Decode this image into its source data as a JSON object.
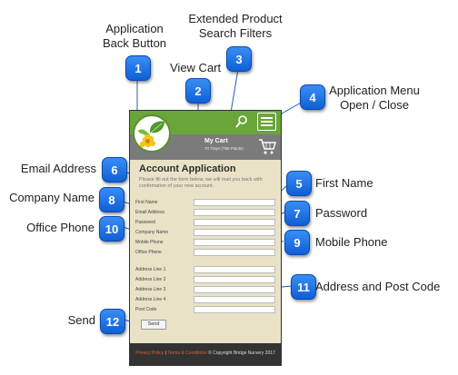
{
  "annotations": [
    {
      "num": "1",
      "text1": "Application",
      "text2": "Back Button"
    },
    {
      "num": "2",
      "text1": "View Cart"
    },
    {
      "num": "3",
      "text1": "Extended Product",
      "text2": "Search Filters"
    },
    {
      "num": "4",
      "text1": "Application Menu",
      "text2": "Open / Close"
    },
    {
      "num": "5",
      "text1": "First Name"
    },
    {
      "num": "6",
      "text1": "Email Address"
    },
    {
      "num": "7",
      "text1": "Password"
    },
    {
      "num": "8",
      "text1": "Company Name"
    },
    {
      "num": "9",
      "text1": "Mobile Phone"
    },
    {
      "num": "10",
      "text1": "Office Phone"
    },
    {
      "num": "11",
      "text1": "Address and Post Code"
    },
    {
      "num": "12",
      "text1": "Send"
    }
  ],
  "app": {
    "cart_title": "My Cart",
    "cart_subtitle": "70 Trays (780 Plants)",
    "form_title": "Account Application",
    "form_description": "Please fill out the form below, we will mail you back with confirmation of your new account.",
    "fields": [
      "First Name",
      "Email Address",
      "Password",
      "Company Name",
      "Mobile Phone",
      "Office Phone"
    ],
    "address_fields": [
      "Address Line 1",
      "Address Line 2",
      "Address Line 3",
      "Address Line 4",
      "Post Code"
    ],
    "send_label": "Send",
    "footer_privacy": "Privacy Policy",
    "footer_sep": "|",
    "footer_terms": "Terms & Conditions",
    "footer_copyright": "© Copyright Bridge Nursery 2017"
  },
  "colors": {
    "badge": "#1a6fe6",
    "topbar": "#6aa53a",
    "cartbar": "#7b7b7b",
    "form_bg": "#e9e2c7",
    "footer": "#333333"
  }
}
